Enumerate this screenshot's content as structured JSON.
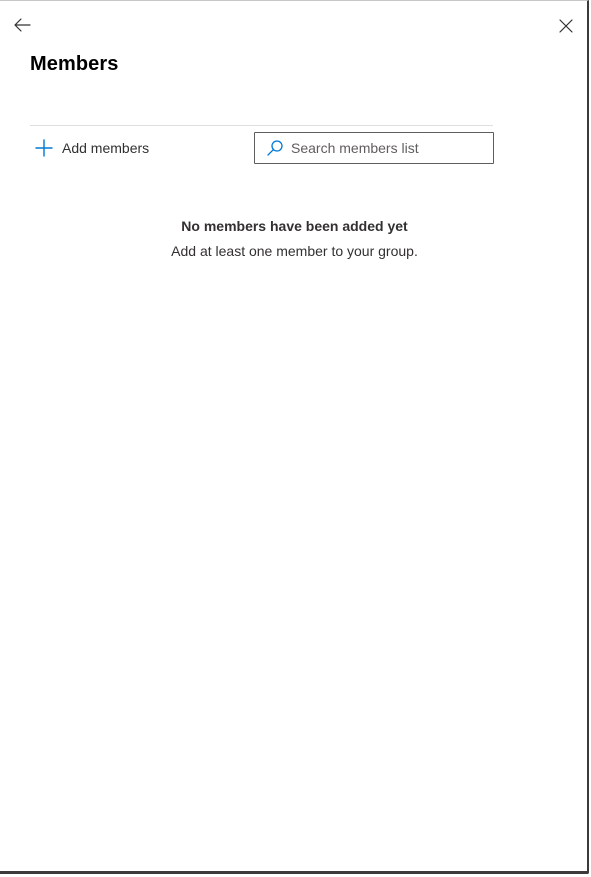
{
  "header": {
    "title": "Members"
  },
  "toolbar": {
    "add_members_label": "Add members",
    "search_placeholder": "Search members list",
    "search_value": ""
  },
  "empty_state": {
    "title": "No members have been added yet",
    "subtitle": "Add at least one member to your group."
  },
  "icons": {
    "back": "back-arrow-icon",
    "close": "close-icon",
    "add": "plus-icon",
    "search": "search-icon"
  },
  "colors": {
    "accent": "#0078d4",
    "text": "#323130",
    "border": "#605e5c"
  }
}
